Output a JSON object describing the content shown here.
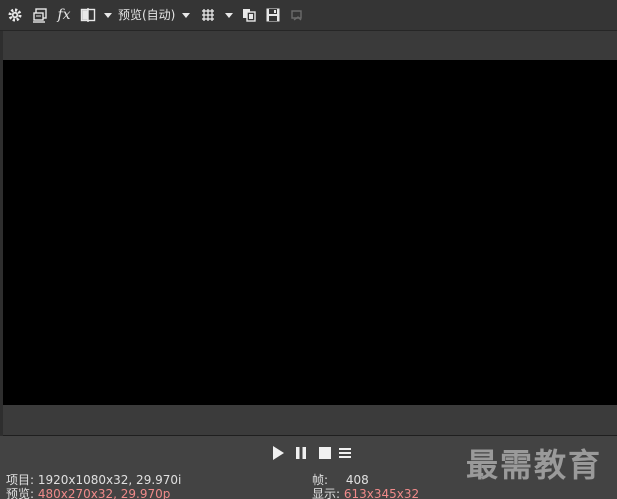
{
  "toolbar": {
    "icons": [
      "gear-icon",
      "properties-icon",
      "fx-icon",
      "split-screen-icon",
      "dropdown-arrow-icon",
      "grid-icon",
      "copy-frame-icon",
      "save-frame-icon",
      "external-monitor-icon"
    ],
    "fx_label": "fx",
    "preview_quality": "预览(自动)"
  },
  "transport": {
    "icons": [
      "play-icon",
      "pause-icon",
      "stop-icon",
      "menu-icon"
    ]
  },
  "info": {
    "project_label": "项目:",
    "project_value": "1920x1080x32, 29.970i",
    "preview_label": "预览:",
    "preview_value": "480x270x32, 29.970p",
    "frame_label": "帧:",
    "frame_value": "408",
    "display_label": "显示:",
    "display_value": "613x345x32"
  },
  "watermark": "最需教育",
  "colors": {
    "background": "#2b2b2b",
    "toolbar": "#353535",
    "controls": "#434343",
    "video": "#000000",
    "highlight_value": "#f08a8a"
  }
}
